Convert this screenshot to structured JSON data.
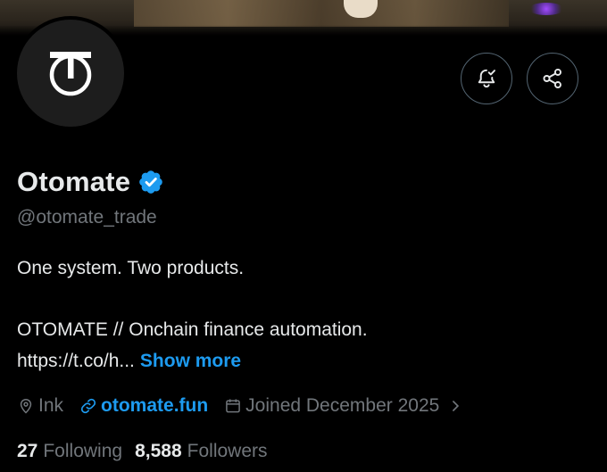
{
  "colors": {
    "background": "#000000",
    "primary_text": "#e7e9ea",
    "secondary_text": "#71767b",
    "accent": "#1d9bf0",
    "button_border": "#536471"
  },
  "header": {
    "avatar_icon": "otomate-logo-icon",
    "notify_icon": "bell-check-icon",
    "share_icon": "share-icon"
  },
  "profile": {
    "name": "Otomate",
    "verified_icon": "verified-badge-icon",
    "handle": "@otomate_trade",
    "bio_line1": "One system. Two products.",
    "bio_line2": "OTOMATE // Onchain finance automation.",
    "bio_url": "https://t.co/h...",
    "show_more": "Show more"
  },
  "meta": {
    "location": "Ink",
    "location_icon": "location-pin-icon",
    "website": "otomate.fun",
    "website_icon": "link-icon",
    "joined": "Joined December 2025",
    "joined_icon": "calendar-icon",
    "expand_icon": "chevron-right-icon"
  },
  "stats": {
    "following_count": "27",
    "following_label": "Following",
    "followers_count": "8,588",
    "followers_label": "Followers"
  }
}
